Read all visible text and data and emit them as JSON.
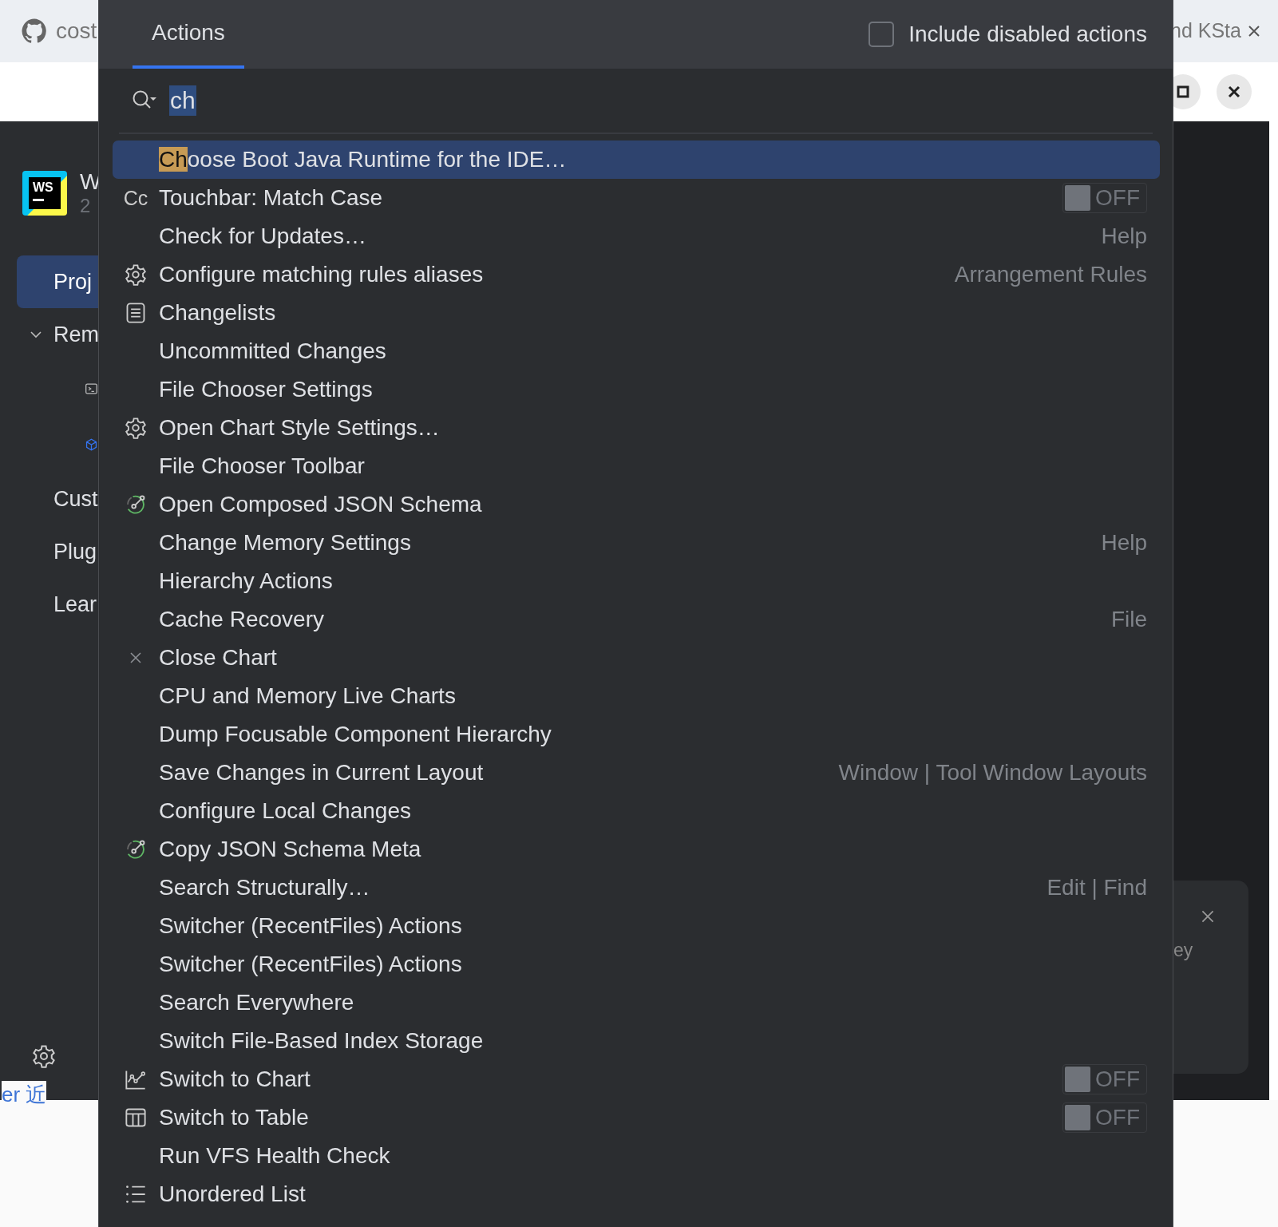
{
  "browser": {
    "tabs": [
      {
        "label": "cost"
      },
      {
        "label": "nd KSta"
      }
    ]
  },
  "ide": {
    "logo_text": "WS",
    "product_name": "W",
    "product_version": "2",
    "nav": [
      {
        "label": "Proj",
        "selected": true,
        "kind": "item"
      },
      {
        "label": "Rem",
        "selected": false,
        "kind": "group",
        "expanded": true
      },
      {
        "kind": "terminal"
      },
      {
        "kind": "cube"
      },
      {
        "label": "Cust",
        "selected": false,
        "kind": "item"
      },
      {
        "label": "Plug",
        "selected": false,
        "kind": "item"
      },
      {
        "label": "Lear",
        "selected": false,
        "kind": "item"
      }
    ],
    "notification": {
      "text": "ey"
    },
    "footer_link": "er 近"
  },
  "popup": {
    "tabs": [
      {
        "label": "Actions",
        "selected": true
      }
    ],
    "include_disabled": {
      "label": "Include disabled actions",
      "checked": false
    },
    "search": {
      "value": "ch"
    },
    "actions": [
      {
        "highlight": "Ch",
        "label": "oose Boot Java Runtime for the IDE…",
        "selected": true
      },
      {
        "label": "Touchbar: Match Case",
        "selected": false,
        "icon_text": "Cc",
        "toggle": {
          "on": false,
          "label": "OFF"
        }
      },
      {
        "label": "Check for Updates…",
        "selected": false,
        "category": "Help"
      },
      {
        "label": "Configure matching rules aliases",
        "selected": false,
        "kind": "gear",
        "category": "Arrangement Rules"
      },
      {
        "label": "Changelists",
        "selected": false,
        "kind": "list"
      },
      {
        "label": "Uncommitted Changes",
        "selected": false
      },
      {
        "label": "File Chooser Settings",
        "selected": false
      },
      {
        "label": "Open Chart Style Settings…",
        "selected": false,
        "kind": "gear"
      },
      {
        "label": "File Chooser Toolbar",
        "selected": false
      },
      {
        "label": "Open Composed JSON Schema",
        "selected": false,
        "kind": "schema"
      },
      {
        "label": "Change Memory Settings",
        "selected": false,
        "category": "Help"
      },
      {
        "label": "Hierarchy Actions",
        "selected": false
      },
      {
        "label": "Cache Recovery",
        "selected": false,
        "category": "File"
      },
      {
        "label": "Close Chart",
        "selected": false,
        "kind": "close"
      },
      {
        "label": "CPU and Memory Live Charts",
        "selected": false
      },
      {
        "label": "Dump Focusable Component Hierarchy",
        "selected": false
      },
      {
        "label": "Save Changes in Current Layout",
        "selected": false,
        "category": "Window | Tool Window Layouts"
      },
      {
        "label": "Configure Local Changes",
        "selected": false
      },
      {
        "label": "Copy JSON Schema Meta",
        "selected": false,
        "kind": "schema"
      },
      {
        "label": "Search Structurally…",
        "selected": false,
        "category": "Edit | Find"
      },
      {
        "label": "Switcher (RecentFiles) Actions",
        "selected": false
      },
      {
        "label": "Switcher (RecentFiles) Actions",
        "selected": false
      },
      {
        "label": "Search Everywhere",
        "selected": false
      },
      {
        "label": "Switch File-Based Index Storage",
        "selected": false
      },
      {
        "label": "Switch to Chart",
        "selected": false,
        "kind": "chart",
        "toggle": {
          "on": false,
          "label": "OFF"
        }
      },
      {
        "label": "Switch to Table",
        "selected": false,
        "kind": "table",
        "toggle": {
          "on": false,
          "label": "OFF"
        }
      },
      {
        "label": "Run VFS Health Check",
        "selected": false
      },
      {
        "label": "Unordered List",
        "selected": false,
        "kind": "bullets"
      }
    ]
  }
}
